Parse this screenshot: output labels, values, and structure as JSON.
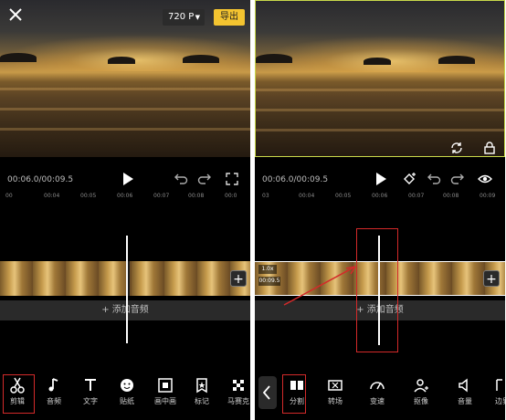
{
  "left": {
    "resolution": "720 P",
    "export_label": "导出",
    "time": "00:06.0/00:09.5",
    "ruler_ticks": [
      "00",
      "00:04",
      "00:05",
      "00:06",
      "00:07",
      "00:08",
      "00:0"
    ],
    "audio_label": "+ 添加音频",
    "toolbar": [
      {
        "label": "剪辑",
        "icon": "scissors-icon"
      },
      {
        "label": "音频",
        "icon": "music-note-icon"
      },
      {
        "label": "文字",
        "icon": "text-icon"
      },
      {
        "label": "贴纸",
        "icon": "sticker-icon"
      },
      {
        "label": "画中画",
        "icon": "picture-in-picture-icon"
      },
      {
        "label": "标记",
        "icon": "bookmark-star-icon"
      },
      {
        "label": "马赛克",
        "icon": "mosaic-icon"
      }
    ]
  },
  "right": {
    "time": "00:06.0/00:09.5",
    "ruler_ticks": [
      "03",
      "00:04",
      "00:05",
      "00:06",
      "00:07",
      "00:08",
      "00:09"
    ],
    "speed_tag": "1.0x",
    "duration_tag": "00:09.5",
    "audio_label": "+ 添加音频",
    "toolbar": [
      {
        "label": "分割",
        "icon": "split-icon"
      },
      {
        "label": "转场",
        "icon": "transition-icon"
      },
      {
        "label": "变速",
        "icon": "speed-gauge-icon"
      },
      {
        "label": "抠像",
        "icon": "cutout-person-icon"
      },
      {
        "label": "音量",
        "icon": "volume-icon"
      },
      {
        "label": "边界",
        "icon": "border-icon"
      }
    ]
  },
  "colors": {
    "accent": "#f4c430",
    "highlight": "#d42a2a",
    "selection": "#c8d84a"
  }
}
